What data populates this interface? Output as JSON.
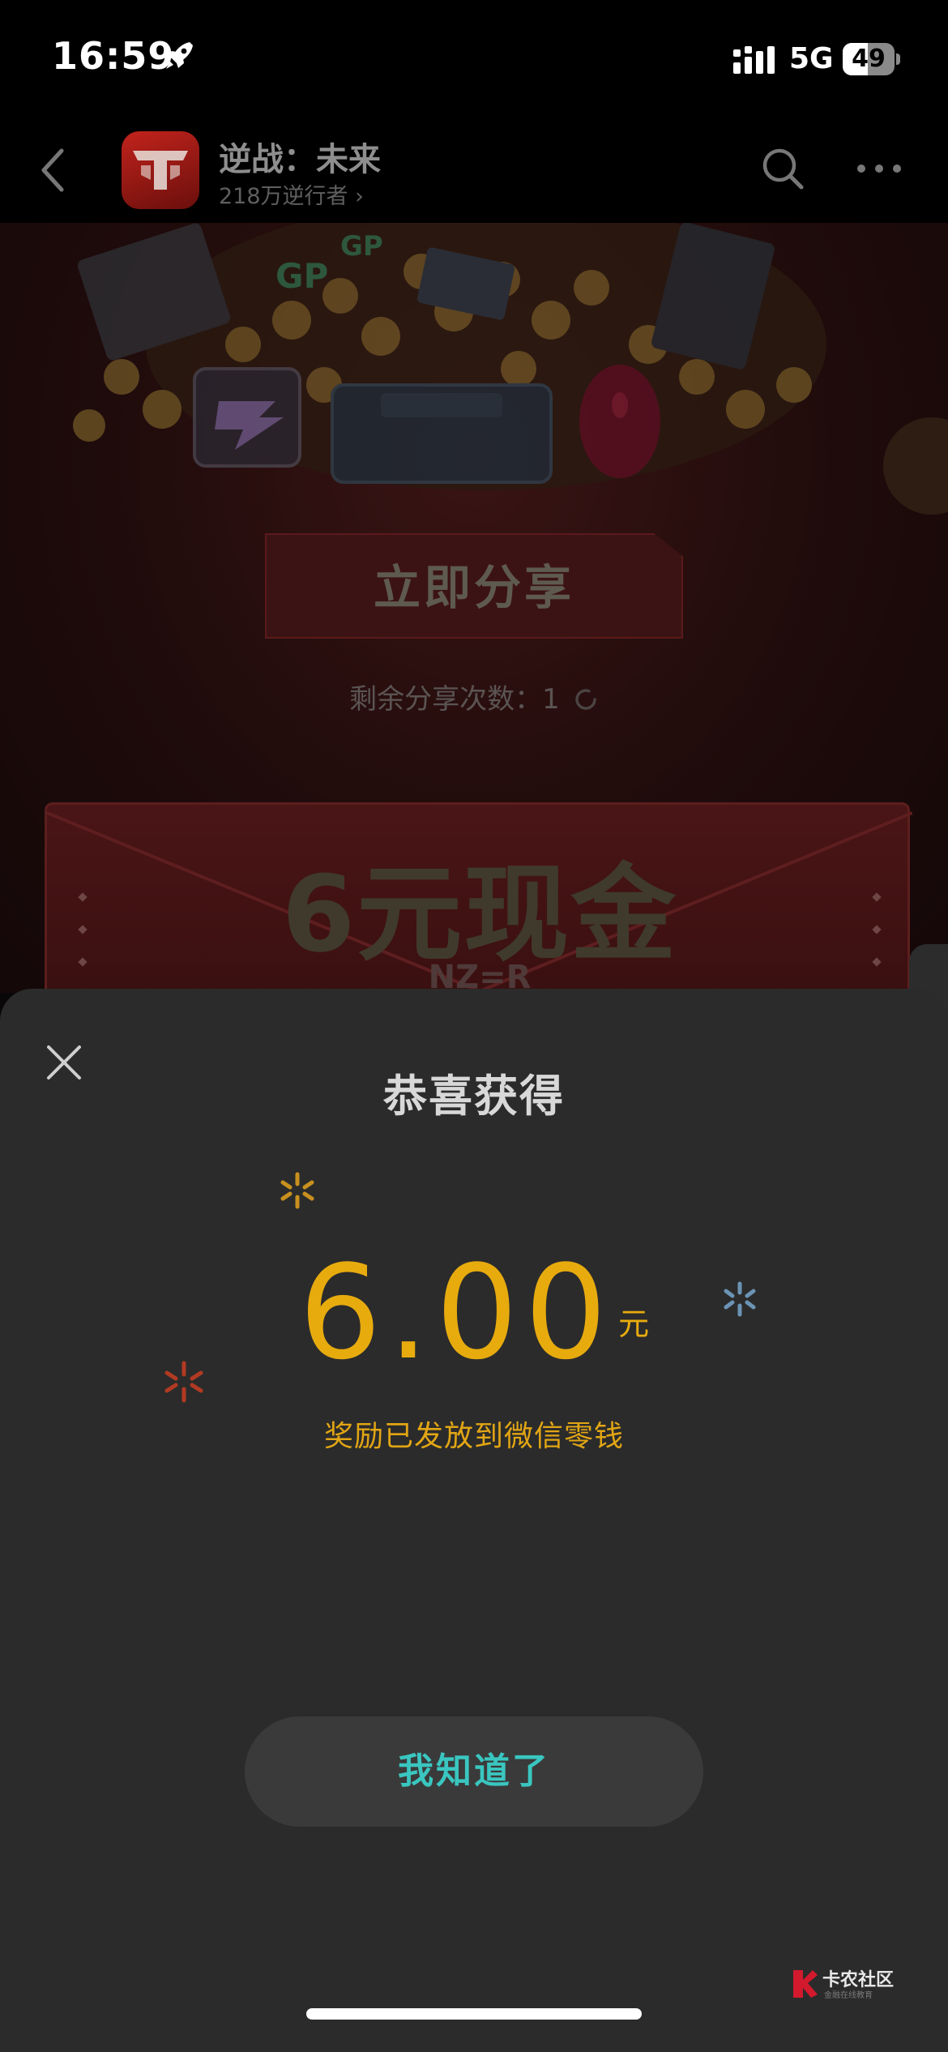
{
  "status_bar": {
    "time": "16:59",
    "network": "5G",
    "battery_level": "49",
    "battery_fraction": 0.49,
    "icons": [
      "rocket-icon",
      "signal-icon",
      "battery-icon"
    ]
  },
  "header": {
    "app_name": "逆战：未来",
    "followers": "218万逆行者 ›",
    "icons": [
      "back-icon",
      "search-icon",
      "more-icon"
    ]
  },
  "event": {
    "share_button": "立即分享",
    "share_count_label": "剩余分享次数：",
    "share_count_value": "1",
    "cash_banner": "6元现金",
    "banner_brand": "NZ=R"
  },
  "modal": {
    "title": "恭喜获得",
    "amount": "6.00",
    "unit": "元",
    "note": "奖励已发放到微信零钱",
    "confirm_button": "我知道了",
    "accent_color": "#e7ab0e",
    "button_text_color": "#3ac6c0"
  },
  "watermark": {
    "name": "卡农社区",
    "sub": "金融在线教育"
  }
}
